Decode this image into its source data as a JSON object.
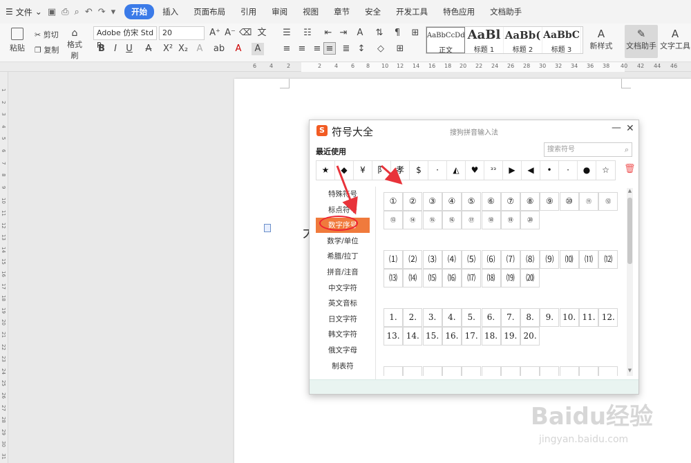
{
  "menu": {
    "file_label": "文件",
    "tabs": [
      "开始",
      "插入",
      "页面布局",
      "引用",
      "审阅",
      "视图",
      "章节",
      "安全",
      "开发工具",
      "特色应用",
      "文档助手"
    ],
    "active_tab": "开始",
    "active_color": "#3b7be8"
  },
  "ribbon": {
    "paste": "粘贴",
    "cut": "剪切",
    "copy": "复制",
    "format_painter": "格式刷",
    "font_name": "Adobe 仿宋 Std R",
    "font_size": "20",
    "styles": [
      {
        "sample": "AaBbCcDd",
        "label": "正文"
      },
      {
        "sample": "AaBl",
        "label": "标题 1"
      },
      {
        "sample": "AaBb(",
        "label": "标题 2"
      },
      {
        "sample": "AaBbC",
        "label": "标题 3"
      }
    ],
    "new_style": "新样式",
    "doc_assistant": "文档助手",
    "text_tools": "文字工具"
  },
  "ruler_numbers": [
    "6",
    "4",
    "2",
    "2",
    "4",
    "6",
    "8",
    "10",
    "12",
    "14",
    "16",
    "18",
    "20",
    "22",
    "24",
    "26",
    "28",
    "30",
    "32",
    "34",
    "36",
    "38",
    "40",
    "42",
    "44",
    "46"
  ],
  "vruler_numbers": [
    "1",
    "2",
    "3",
    "4",
    "5",
    "6",
    "7",
    "8",
    "9",
    "10",
    "11",
    "12",
    "13",
    "14",
    "15",
    "16",
    "17",
    "18",
    "19",
    "20",
    "21",
    "22",
    "23",
    "24",
    "25",
    "26",
    "27",
    "28",
    "29",
    "30",
    "31"
  ],
  "document": {
    "char": "大"
  },
  "dialog": {
    "logo": "S",
    "title": "符号大全",
    "subtitle": "搜狗拼音输入法",
    "recent_label": "最近使用",
    "search_placeholder": "搜索符号",
    "recent_symbols": [
      "★",
      "◆",
      "¥",
      "阝",
      "孝",
      "$",
      "·",
      "◭",
      "♥",
      "ᵌᵌ",
      "▶",
      "◀",
      "•",
      "·",
      "●",
      "☆"
    ],
    "categories": [
      "特殊符号",
      "标点符号",
      "数字序号",
      "数学/单位",
      "希腊/拉丁",
      "拼音/注音",
      "中文字符",
      "英文音标",
      "日文字符",
      "韩文字符",
      "俄文字母",
      "制表符"
    ],
    "active_category": "数字序号",
    "accent_color": "#f07a3c",
    "groups": [
      [
        "①",
        "②",
        "③",
        "④",
        "⑤",
        "⑥",
        "⑦",
        "⑧",
        "⑨",
        "⑩",
        "⑪",
        "⑫",
        "⑬",
        "⑭",
        "⑮",
        "⑯",
        "⑰",
        "⑱",
        "⑲",
        "⑳"
      ],
      [
        "⑴",
        "⑵",
        "⑶",
        "⑷",
        "⑸",
        "⑹",
        "⑺",
        "⑻",
        "⑼",
        "⑽",
        "⑾",
        "⑿",
        "⒀",
        "⒁",
        "⒂",
        "⒃",
        "⒄",
        "⒅",
        "⒆",
        "⒇"
      ],
      [
        "1.",
        "2.",
        "3.",
        "4.",
        "5.",
        "6.",
        "7.",
        "8.",
        "9.",
        "10.",
        "11.",
        "12.",
        "13.",
        "14.",
        "15.",
        "16.",
        "17.",
        "18.",
        "19.",
        "20."
      ]
    ]
  },
  "watermark": {
    "main": "Baidu经验",
    "url": "jingyan.baidu.com"
  }
}
